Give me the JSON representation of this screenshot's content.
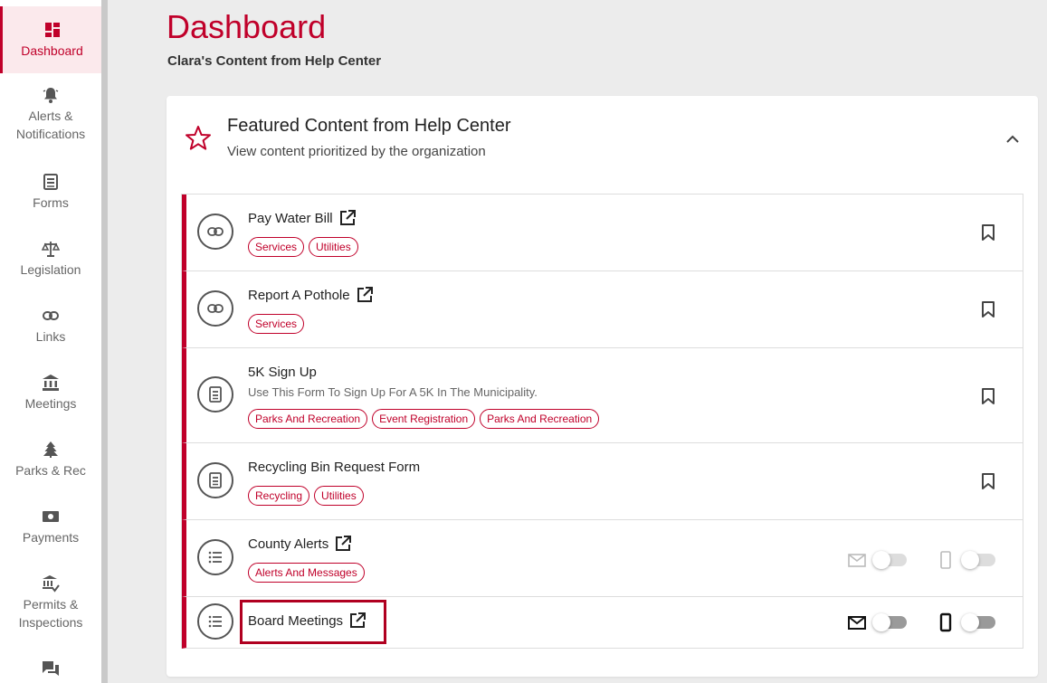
{
  "sidebar": {
    "items": [
      {
        "label": "Dashboard",
        "icon": "dashboard-icon"
      },
      {
        "label": "Alerts &\nNotifications",
        "icon": "bell-icon"
      },
      {
        "label": "Forms",
        "icon": "form-icon"
      },
      {
        "label": "Legislation",
        "icon": "scales-icon"
      },
      {
        "label": "Links",
        "icon": "link-icon"
      },
      {
        "label": "Meetings",
        "icon": "building-icon"
      },
      {
        "label": "Parks & Rec",
        "icon": "tree-icon"
      },
      {
        "label": "Payments",
        "icon": "money-icon"
      },
      {
        "label": "Permits &\nInspections",
        "icon": "permit-icon"
      },
      {
        "label": "",
        "icon": "chat-icon"
      }
    ]
  },
  "header": {
    "title": "Dashboard",
    "subtitle": "Clara's Content from Help Center"
  },
  "card": {
    "title": "Featured Content from Help Center",
    "description": "View content prioritized by the organization"
  },
  "rows": [
    {
      "title": "Pay Water Bill",
      "icon": "link-icon",
      "external": true,
      "description": "",
      "tags": [
        "Services",
        "Utilities"
      ],
      "action": "bookmark"
    },
    {
      "title": "Report A Pothole",
      "icon": "link-icon",
      "external": true,
      "description": "",
      "tags": [
        "Services"
      ],
      "action": "bookmark"
    },
    {
      "title": "5K Sign Up",
      "icon": "form-icon",
      "external": false,
      "description": "Use This Form To Sign Up For A 5K In The Municipality.",
      "tags": [
        "Parks And Recreation",
        "Event Registration",
        "Parks And Recreation"
      ],
      "action": "bookmark"
    },
    {
      "title": "Recycling Bin Request Form",
      "icon": "form-icon",
      "external": false,
      "description": "",
      "tags": [
        "Recycling",
        "Utilities"
      ],
      "action": "bookmark"
    },
    {
      "title": "County Alerts",
      "icon": "list-icon",
      "external": true,
      "description": "",
      "tags": [
        "Alerts And Messages"
      ],
      "action": "notify",
      "notify_state": "disabled"
    },
    {
      "title": "Board Meetings",
      "icon": "list-icon",
      "external": true,
      "description": "",
      "tags": [],
      "action": "notify",
      "notify_state": "enabled"
    }
  ],
  "colors": {
    "accent": "#c0002a",
    "background": "#ececec"
  }
}
